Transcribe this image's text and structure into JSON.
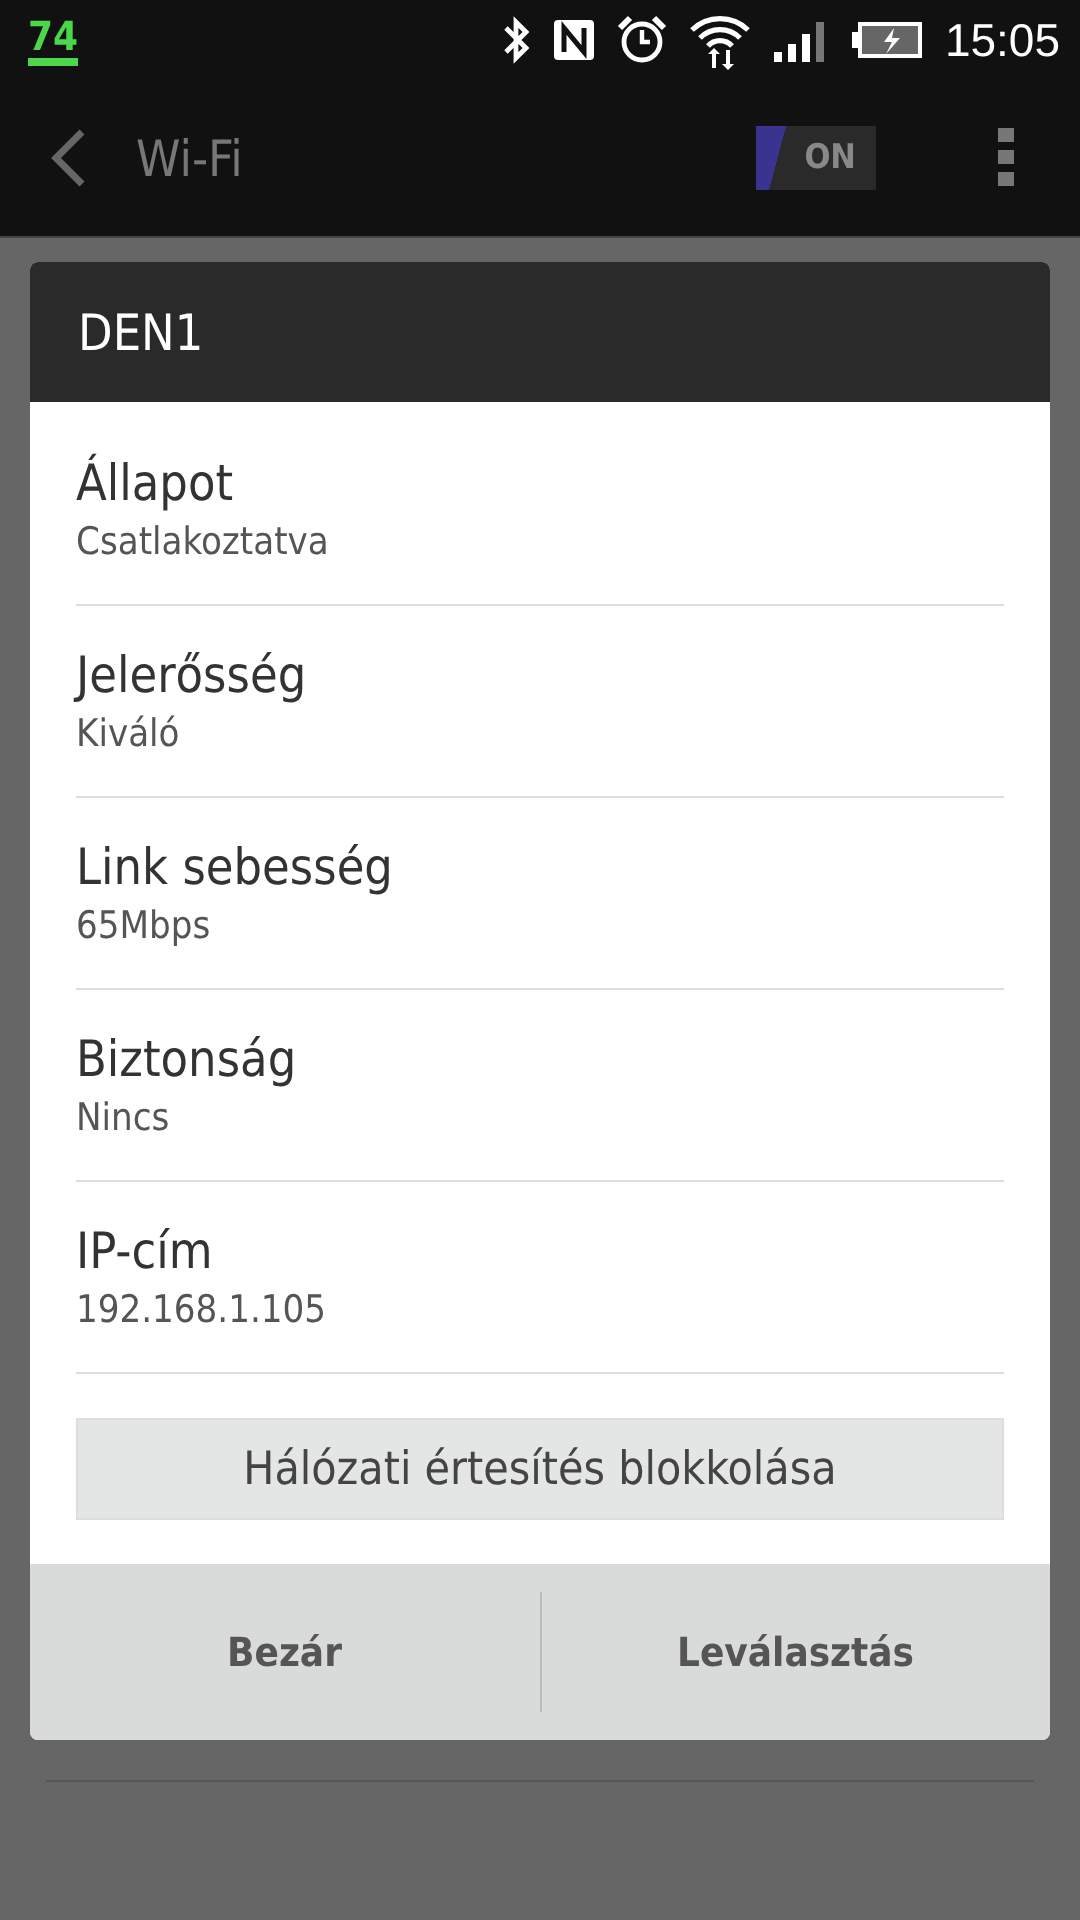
{
  "status_bar": {
    "notification": "74",
    "time": "15:05"
  },
  "action_bar": {
    "title": "Wi-Fi",
    "toggle": {
      "label": "ON",
      "on": true
    }
  },
  "dialog": {
    "title": "DEN1",
    "fields": [
      {
        "label": "Állapot",
        "value": "Csatlakoztatva"
      },
      {
        "label": "Jelerősség",
        "value": "Kiváló"
      },
      {
        "label": "Link sebesség",
        "value": "65Mbps"
      },
      {
        "label": "Biztonság",
        "value": "Nincs"
      },
      {
        "label": "IP-cím",
        "value": "192.168.1.105"
      }
    ],
    "action": "Hálózati értesítés blokkolása",
    "buttons": [
      "Bezár",
      "Leválasztás"
    ]
  }
}
